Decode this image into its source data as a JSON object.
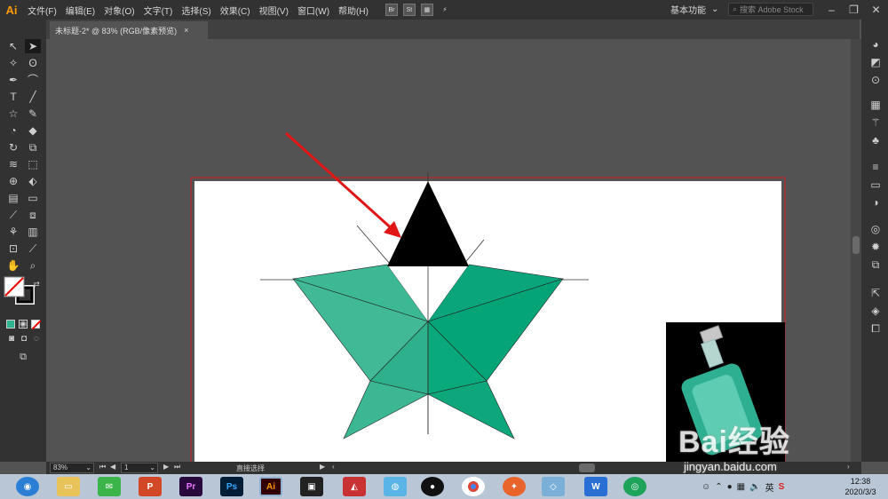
{
  "app": {
    "logo": "Ai"
  },
  "menu": [
    "文件(F)",
    "编辑(E)",
    "对象(O)",
    "文字(T)",
    "选择(S)",
    "效果(C)",
    "视图(V)",
    "窗口(W)",
    "帮助(H)"
  ],
  "menu_icons": [
    "Br",
    "St"
  ],
  "workspace_label": "基本功能",
  "search_placeholder": "搜索 Adobe Stock",
  "document_tab": {
    "title": "未标题-2* @ 83% (RGB/像素预览)",
    "close": "×"
  },
  "status": {
    "zoom": "83%",
    "page": "1",
    "tool": "直接选择"
  },
  "watermark": {
    "main": "Bai经验",
    "url": "jingyan.baidu.com"
  },
  "clock": {
    "time": "12:38",
    "date": "2020/3/3"
  },
  "tray_lang": "英",
  "colors": {
    "star_green": "#2fb38e",
    "triangle": "#000000",
    "arrow": "#e01515",
    "artboard_border": "#cc2222"
  }
}
